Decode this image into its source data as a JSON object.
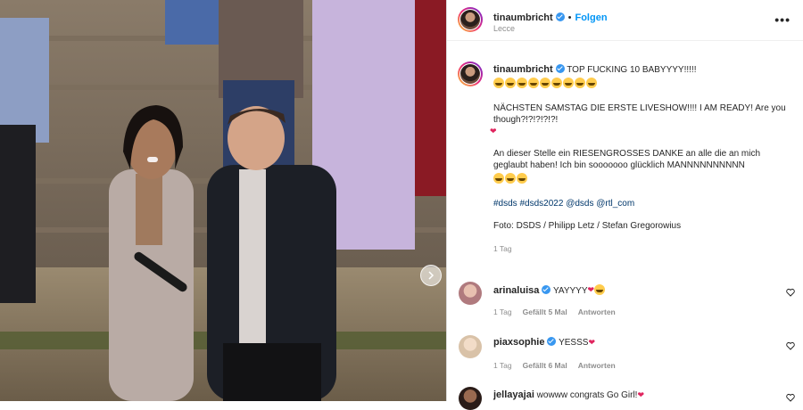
{
  "post_header": {
    "username": "tinaumbricht",
    "separator": "•",
    "follow_label": "Folgen",
    "location": "Lecce",
    "more_icon": "more-horizontal-icon"
  },
  "caption": {
    "username": "tinaumbricht",
    "line1": "TOP FUCKING 10 BABYYYY!!!!!",
    "line2": "NÄCHSTEN SAMSTAG DIE ERSTE LIVESHOW!!!! I AM READY! Are you though?!?!?!?!?!",
    "line3": "An dieser Stelle ein RIESENGROSSES DANKE an alle die an mich geglaubt haben! Ich bin sooooooo glücklich MANNNNNNNNNN",
    "hashtags": [
      "#dsds",
      "#dsds2022",
      "@dsds",
      "@rtl_com"
    ],
    "credit": "Foto: DSDS / Philipp Letz / Stefan Gregorowius",
    "age": "1 Tag"
  },
  "comments": [
    {
      "username": "arinaluisa",
      "verified": true,
      "text": "YAYYYY",
      "age": "1 Tag",
      "likes": "Gefällt 5 Mal",
      "reply": "Antworten"
    },
    {
      "username": "piaxsophie",
      "verified": true,
      "text": "YESSS",
      "age": "1 Tag",
      "likes": "Gefällt 6 Mal",
      "reply": "Antworten"
    },
    {
      "username": "jellayajai",
      "verified": false,
      "text": "wowww congrats Go Girl!",
      "age": "",
      "likes": "",
      "reply": ""
    }
  ],
  "colors": {
    "link": "#0095f6",
    "verified": "#3897f0",
    "heart": "#e0245e",
    "muted": "#8e8e8e"
  }
}
